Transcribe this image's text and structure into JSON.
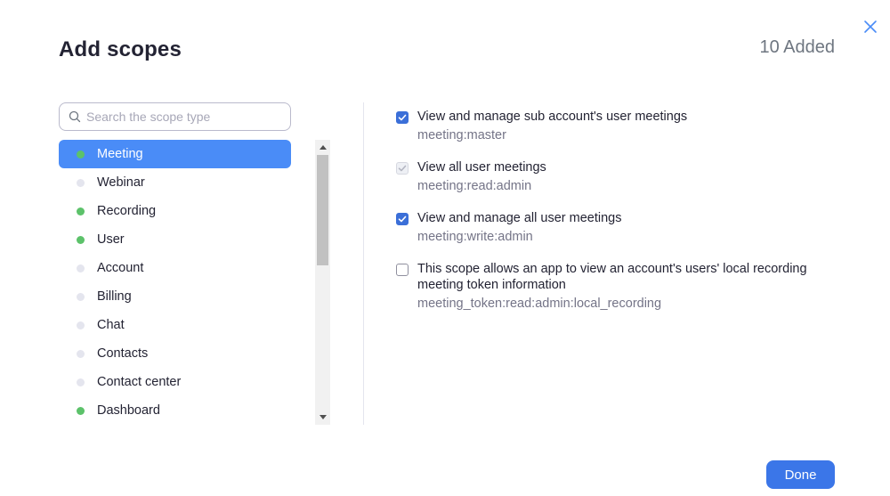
{
  "dialog": {
    "title": "Add scopes",
    "added_count": "10 Added",
    "done_label": "Done"
  },
  "search": {
    "placeholder": "Search the scope type",
    "value": ""
  },
  "scope_types": [
    {
      "label": "Meeting",
      "has_selection": true,
      "active": true
    },
    {
      "label": "Webinar",
      "has_selection": false,
      "active": false
    },
    {
      "label": "Recording",
      "has_selection": true,
      "active": false
    },
    {
      "label": "User",
      "has_selection": true,
      "active": false
    },
    {
      "label": "Account",
      "has_selection": false,
      "active": false
    },
    {
      "label": "Billing",
      "has_selection": false,
      "active": false
    },
    {
      "label": "Chat",
      "has_selection": false,
      "active": false
    },
    {
      "label": "Contacts",
      "has_selection": false,
      "active": false
    },
    {
      "label": "Contact center",
      "has_selection": false,
      "active": false
    },
    {
      "label": "Dashboard",
      "has_selection": true,
      "active": false
    }
  ],
  "permissions": [
    {
      "title": "View and manage sub account's user meetings",
      "scope": "meeting:master",
      "state": "checked"
    },
    {
      "title": "View all user meetings",
      "scope": "meeting:read:admin",
      "state": "checked-disabled"
    },
    {
      "title": "View and manage all user meetings",
      "scope": "meeting:write:admin",
      "state": "checked"
    },
    {
      "title": "This scope allows an app to view an account's users' local recording meeting token information",
      "scope": "meeting_token:read:admin:local_recording",
      "state": "unchecked"
    }
  ],
  "colors": {
    "accent": "#4a8cf7",
    "checkbox": "#3b6fd8",
    "dot_selected": "#5cc26a",
    "dot_empty": "#e4e5ee"
  },
  "icons": {
    "close": "close-icon",
    "search": "search-icon",
    "check": "check-icon"
  }
}
